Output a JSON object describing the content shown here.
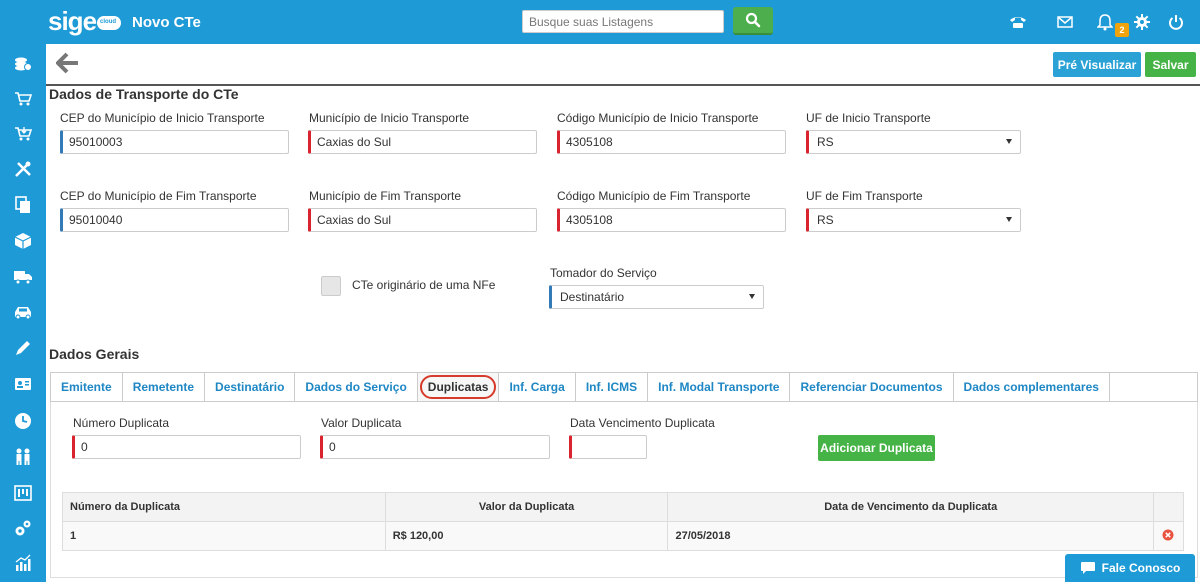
{
  "header": {
    "logo_text": "sige",
    "logo_sub": "cloud",
    "title": "Novo CTe",
    "search_placeholder": "Busque suas Listagens",
    "notification_count": "2"
  },
  "sidebar": {
    "items": [
      "money-icon",
      "cart-icon",
      "cart-in-icon",
      "tools-icon",
      "copy-icon",
      "box-icon",
      "truck-icon",
      "car-icon",
      "pen-icon",
      "id-card-icon",
      "clock-icon",
      "people-icon",
      "kanban-icon",
      "gears-icon",
      "chart-icon"
    ]
  },
  "toolbar": {
    "preview_label": "Pré Visualizar",
    "save_label": "Salvar"
  },
  "transport": {
    "title": "Dados de Transporte do CTe",
    "cep_inicio_label": "CEP do Município de Inicio Transporte",
    "cep_inicio": "95010003",
    "mun_inicio_label": "Município de Inicio Transporte",
    "mun_inicio": "Caxias do Sul",
    "cod_inicio_label": "Código Município de Inicio Transporte",
    "cod_inicio": "4305108",
    "uf_inicio_label": "UF de Inicio Transporte",
    "uf_inicio": "RS",
    "cep_fim_label": "CEP do Município de Fim Transporte",
    "cep_fim": "95010040",
    "mun_fim_label": "Município de Fim Transporte",
    "mun_fim": "Caxias do Sul",
    "cod_fim_label": "Código Município de Fim Transporte",
    "cod_fim": "4305108",
    "uf_fim_label": "UF de Fim Transporte",
    "uf_fim": "RS",
    "nfe_label": "CTe originário de uma NFe",
    "tomador_label": "Tomador do Serviço",
    "tomador": "Destinatário"
  },
  "general": {
    "title": "Dados Gerais",
    "tabs": [
      "Emitente",
      "Remetente",
      "Destinatário",
      "Dados do Serviço",
      "Duplicatas",
      "Inf. Carga",
      "Inf. ICMS",
      "Inf. Modal Transporte",
      "Referenciar Documentos",
      "Dados complementares"
    ],
    "active_tab": "Duplicatas"
  },
  "duplicatas": {
    "numero_label": "Número Duplicata",
    "numero": "0",
    "valor_label": "Valor Duplicata",
    "valor": "0",
    "vencimento_label": "Data Vencimento Duplicata",
    "vencimento": "",
    "add_label": "Adicionar Duplicata",
    "columns": [
      "Número da Duplicata",
      "Valor da Duplicata",
      "Data de Vencimento da Duplicata"
    ],
    "rows": [
      {
        "numero": "1",
        "valor": "R$ 120,00",
        "vencimento": "27/05/2018"
      }
    ]
  },
  "chat": {
    "label": "Fale Conosco"
  }
}
